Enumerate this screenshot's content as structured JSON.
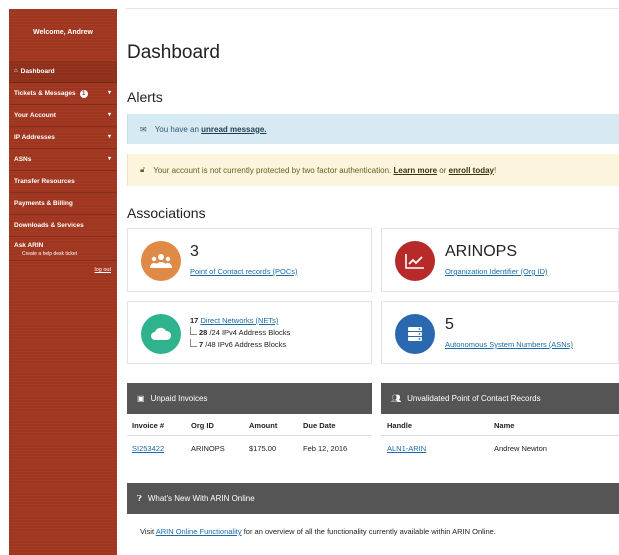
{
  "sidebar": {
    "welcome": "Welcome, Andrew",
    "items": [
      {
        "label": "Dashboard",
        "icon": "home-icon",
        "active": true
      },
      {
        "label": "Tickets & Messages",
        "badge": "1",
        "caret": "▾"
      },
      {
        "label": "Your Account",
        "caret": "▾"
      },
      {
        "label": "IP Addresses",
        "caret": "▾"
      },
      {
        "label": "ASNs",
        "caret": "▾"
      },
      {
        "label": "Transfer Resources"
      },
      {
        "label": "Payments & Billing"
      },
      {
        "label": "Downloads & Services"
      }
    ],
    "ask": {
      "title": "Ask ARIN",
      "subtitle": "Create a help desk ticket"
    },
    "logout": "log out"
  },
  "main": {
    "title": "Dashboard",
    "alerts_heading": "Alerts",
    "alert_info": {
      "prefix": "You have an",
      "link": "unread message."
    },
    "alert_warn": {
      "text": "Your account is not currently protected by two factor authentication.",
      "link1": "Learn more",
      "mid": "or",
      "link2": "enroll today",
      "suffix": "!"
    },
    "associations_heading": "Associations",
    "cards": {
      "poc": {
        "count": "3",
        "link": "Point of Contact records (POCs)"
      },
      "org": {
        "name": "ARINOPS",
        "link": "Organization Identifier (Org ID)"
      },
      "nets": {
        "count": "17",
        "link": "Direct Networks (NETs)",
        "ipv4_count": "28",
        "ipv4_text": "/24 IPv4 Address Blocks",
        "ipv6_count": "7",
        "ipv6_text": "/48 IPv6 Address Blocks"
      },
      "asn": {
        "count": "5",
        "link": "Autonomous System Numbers (ASNs)"
      }
    },
    "invoices": {
      "title": "Unpaid Invoices",
      "columns": [
        "Invoice #",
        "Org ID",
        "Amount",
        "Due Date"
      ],
      "rows": [
        [
          "SI253422",
          "ARINOPS",
          "$175.00",
          "Feb 12, 2016"
        ]
      ]
    },
    "pocs_panel": {
      "title": "Unvalidated Point of Contact Records",
      "columns": [
        "Handle",
        "Name"
      ],
      "rows": [
        [
          "ALN1-ARIN",
          "Andrew Newton"
        ]
      ]
    },
    "whatsnew": {
      "title": "What's New With ARIN Online",
      "prefix": "Visit",
      "link": "ARIN Online Functionality",
      "suffix": "for an overview of all the functionality currently available within ARIN Online."
    }
  },
  "colors": {
    "sidebar": "#a0361f",
    "poc_circle": "#e08a47",
    "org_circle": "#b82a2a",
    "nets_circle": "#2fb38f",
    "asn_circle": "#2a68b0",
    "panel_header": "#555555",
    "link": "#1a6ca8"
  }
}
